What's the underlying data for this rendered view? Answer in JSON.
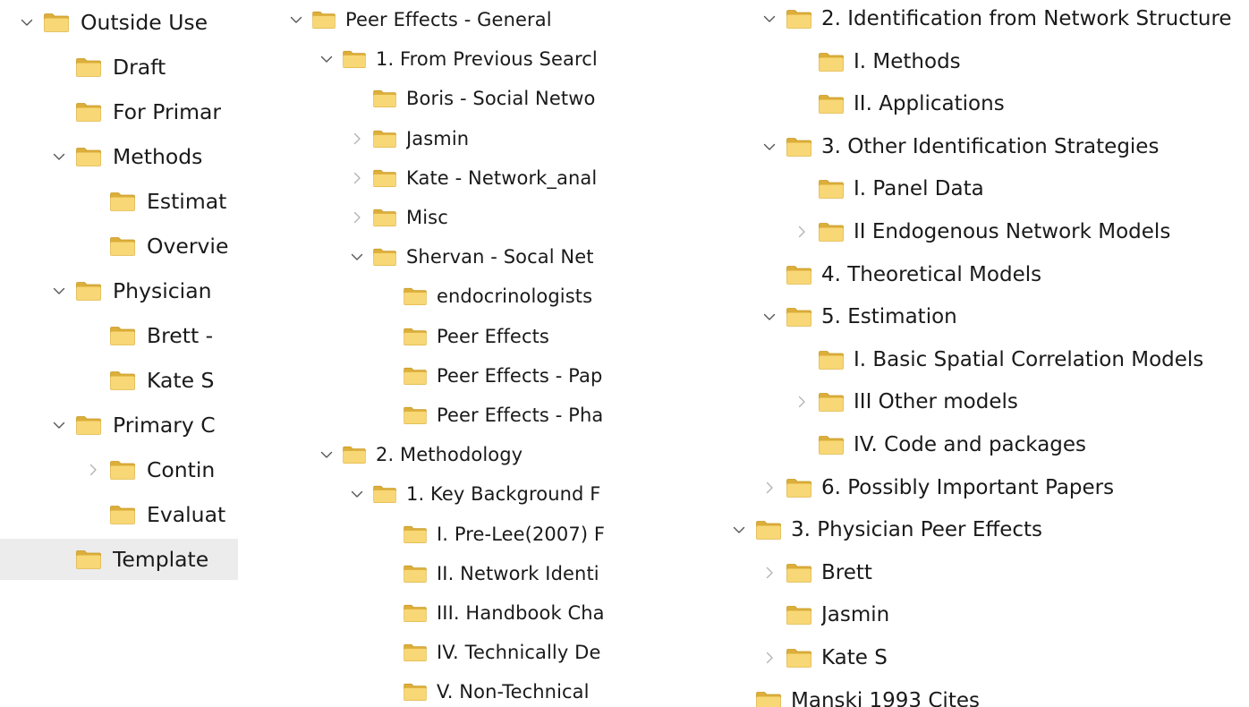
{
  "colors": {
    "folder_back": "#dcae3a",
    "folder_front": "#f8d776",
    "folder_edge": "#c99a24",
    "selection": "#ececec",
    "chevron_dark": "#555555",
    "chevron_light": "#b4b4b4"
  },
  "panes": [
    {
      "name": "tree-pane-outside-use",
      "rows": [
        {
          "label": "Outside Use",
          "depth": 0,
          "chevron": "down",
          "chevron_tone": "dark"
        },
        {
          "label": "Draft",
          "depth": 1,
          "chevron": "none"
        },
        {
          "label": "For Primar",
          "depth": 1,
          "chevron": "none"
        },
        {
          "label": "Methods",
          "depth": 1,
          "chevron": "down",
          "chevron_tone": "dark"
        },
        {
          "label": "Estimat",
          "depth": 2,
          "chevron": "none"
        },
        {
          "label": "Overvie",
          "depth": 2,
          "chevron": "none"
        },
        {
          "label": "Physician",
          "depth": 1,
          "chevron": "down",
          "chevron_tone": "dark"
        },
        {
          "label": "Brett -",
          "depth": 2,
          "chevron": "none"
        },
        {
          "label": "Kate S",
          "depth": 2,
          "chevron": "none"
        },
        {
          "label": "Primary C",
          "depth": 1,
          "chevron": "down",
          "chevron_tone": "dark"
        },
        {
          "label": "Contin",
          "depth": 2,
          "chevron": "right",
          "chevron_tone": "light"
        },
        {
          "label": "Evaluat",
          "depth": 2,
          "chevron": "none"
        },
        {
          "label": "Template",
          "depth": 1,
          "chevron": "none",
          "selected": true
        }
      ]
    },
    {
      "name": "tree-pane-peer-effects-general",
      "rows": [
        {
          "label": "Peer Effects - General",
          "depth": 0,
          "chevron": "down",
          "chevron_tone": "dark"
        },
        {
          "label": "1. From Previous Searcl",
          "depth": 1,
          "chevron": "down",
          "chevron_tone": "dark"
        },
        {
          "label": "Boris - Social Netwo",
          "depth": 2,
          "chevron": "none"
        },
        {
          "label": "Jasmin",
          "depth": 2,
          "chevron": "right",
          "chevron_tone": "light"
        },
        {
          "label": "Kate - Network_anal",
          "depth": 2,
          "chevron": "right",
          "chevron_tone": "light"
        },
        {
          "label": "Misc",
          "depth": 2,
          "chevron": "right",
          "chevron_tone": "light"
        },
        {
          "label": "Shervan - Socal Net",
          "depth": 2,
          "chevron": "down",
          "chevron_tone": "dark"
        },
        {
          "label": "endocrinologists",
          "depth": 3,
          "chevron": "none"
        },
        {
          "label": "Peer Effects",
          "depth": 3,
          "chevron": "none"
        },
        {
          "label": "Peer Effects - Pap",
          "depth": 3,
          "chevron": "none"
        },
        {
          "label": "Peer Effects - Pha",
          "depth": 3,
          "chevron": "none"
        },
        {
          "label": "2. Methodology",
          "depth": 1,
          "chevron": "down",
          "chevron_tone": "dark"
        },
        {
          "label": "1. Key Background F",
          "depth": 2,
          "chevron": "down",
          "chevron_tone": "dark"
        },
        {
          "label": "I. Pre-Lee(2007) F",
          "depth": 3,
          "chevron": "none"
        },
        {
          "label": "II. Network Identi",
          "depth": 3,
          "chevron": "none"
        },
        {
          "label": "III. Handbook Cha",
          "depth": 3,
          "chevron": "none"
        },
        {
          "label": "IV. Technically De",
          "depth": 3,
          "chevron": "none"
        },
        {
          "label": "V. Non-Technical",
          "depth": 3,
          "chevron": "none"
        }
      ]
    },
    {
      "name": "tree-pane-methodology-continued",
      "rows": [
        {
          "label": "2. Identification from Network Structure",
          "depth": 1,
          "chevron": "down",
          "chevron_tone": "dark"
        },
        {
          "label": "I. Methods",
          "depth": 2,
          "chevron": "none"
        },
        {
          "label": "II. Applications",
          "depth": 2,
          "chevron": "none"
        },
        {
          "label": "3. Other Identification Strategies",
          "depth": 1,
          "chevron": "down",
          "chevron_tone": "dark"
        },
        {
          "label": "I. Panel Data",
          "depth": 2,
          "chevron": "none"
        },
        {
          "label": "II Endogenous Network Models",
          "depth": 2,
          "chevron": "right",
          "chevron_tone": "light"
        },
        {
          "label": "4. Theoretical Models",
          "depth": 1,
          "chevron": "none"
        },
        {
          "label": "5. Estimation",
          "depth": 1,
          "chevron": "down",
          "chevron_tone": "dark"
        },
        {
          "label": "I. Basic Spatial Correlation Models",
          "depth": 2,
          "chevron": "none"
        },
        {
          "label": "III Other models",
          "depth": 2,
          "chevron": "right",
          "chevron_tone": "light"
        },
        {
          "label": "IV. Code and packages",
          "depth": 2,
          "chevron": "none"
        },
        {
          "label": "6. Possibly Important Papers",
          "depth": 1,
          "chevron": "right",
          "chevron_tone": "light"
        },
        {
          "label": "3. Physician Peer Effects",
          "depth": 0,
          "chevron": "down",
          "chevron_tone": "dark"
        },
        {
          "label": "Brett",
          "depth": 1,
          "chevron": "right",
          "chevron_tone": "light"
        },
        {
          "label": "Jasmin",
          "depth": 1,
          "chevron": "none"
        },
        {
          "label": "Kate S",
          "depth": 1,
          "chevron": "right",
          "chevron_tone": "light"
        },
        {
          "label": "Manski 1993 Cites",
          "depth": 0,
          "chevron": "none"
        }
      ]
    }
  ]
}
